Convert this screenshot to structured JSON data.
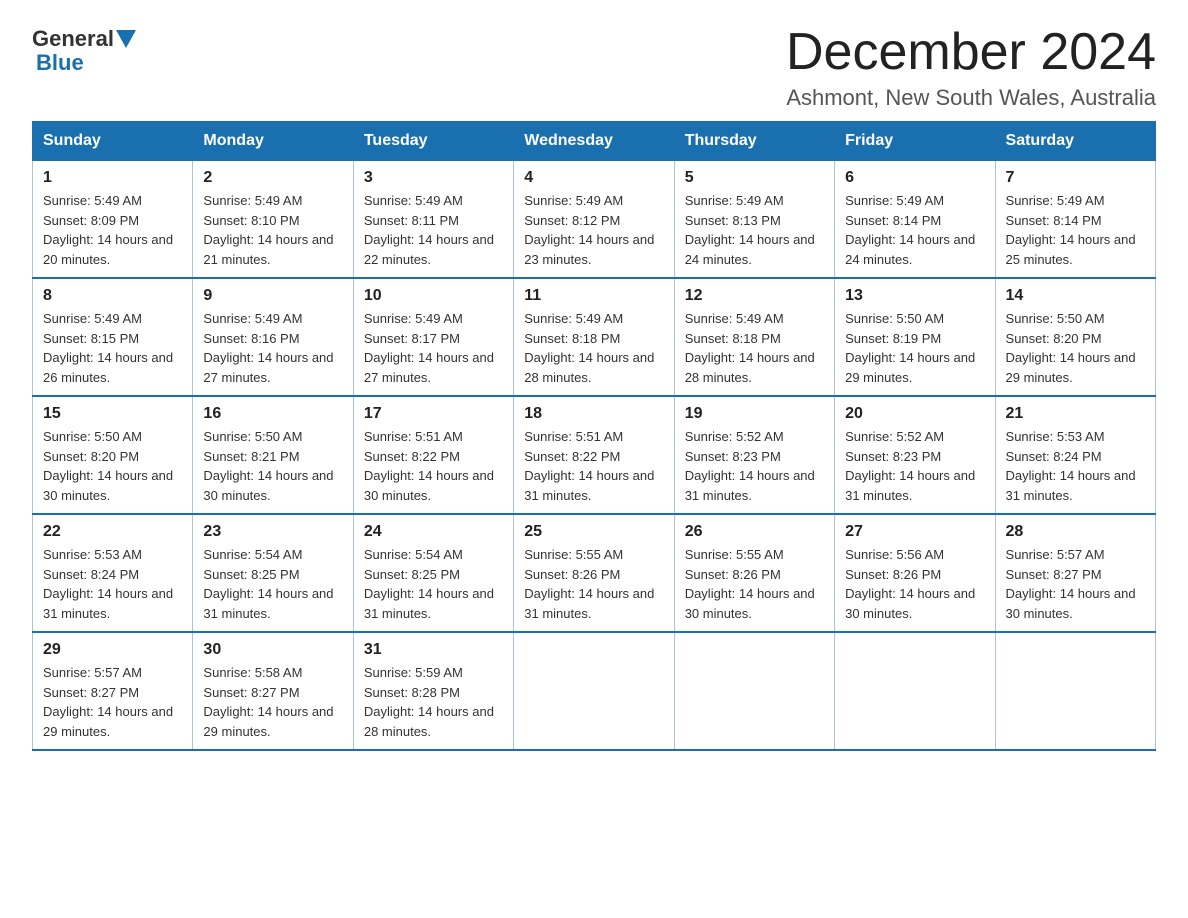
{
  "header": {
    "logo_general": "General",
    "logo_blue": "Blue",
    "month_title": "December 2024",
    "location": "Ashmont, New South Wales, Australia"
  },
  "weekdays": [
    "Sunday",
    "Monday",
    "Tuesday",
    "Wednesday",
    "Thursday",
    "Friday",
    "Saturday"
  ],
  "weeks": [
    [
      {
        "day": "1",
        "sunrise": "5:49 AM",
        "sunset": "8:09 PM",
        "daylight": "14 hours and 20 minutes."
      },
      {
        "day": "2",
        "sunrise": "5:49 AM",
        "sunset": "8:10 PM",
        "daylight": "14 hours and 21 minutes."
      },
      {
        "day": "3",
        "sunrise": "5:49 AM",
        "sunset": "8:11 PM",
        "daylight": "14 hours and 22 minutes."
      },
      {
        "day": "4",
        "sunrise": "5:49 AM",
        "sunset": "8:12 PM",
        "daylight": "14 hours and 23 minutes."
      },
      {
        "day": "5",
        "sunrise": "5:49 AM",
        "sunset": "8:13 PM",
        "daylight": "14 hours and 24 minutes."
      },
      {
        "day": "6",
        "sunrise": "5:49 AM",
        "sunset": "8:14 PM",
        "daylight": "14 hours and 24 minutes."
      },
      {
        "day": "7",
        "sunrise": "5:49 AM",
        "sunset": "8:14 PM",
        "daylight": "14 hours and 25 minutes."
      }
    ],
    [
      {
        "day": "8",
        "sunrise": "5:49 AM",
        "sunset": "8:15 PM",
        "daylight": "14 hours and 26 minutes."
      },
      {
        "day": "9",
        "sunrise": "5:49 AM",
        "sunset": "8:16 PM",
        "daylight": "14 hours and 27 minutes."
      },
      {
        "day": "10",
        "sunrise": "5:49 AM",
        "sunset": "8:17 PM",
        "daylight": "14 hours and 27 minutes."
      },
      {
        "day": "11",
        "sunrise": "5:49 AM",
        "sunset": "8:18 PM",
        "daylight": "14 hours and 28 minutes."
      },
      {
        "day": "12",
        "sunrise": "5:49 AM",
        "sunset": "8:18 PM",
        "daylight": "14 hours and 28 minutes."
      },
      {
        "day": "13",
        "sunrise": "5:50 AM",
        "sunset": "8:19 PM",
        "daylight": "14 hours and 29 minutes."
      },
      {
        "day": "14",
        "sunrise": "5:50 AM",
        "sunset": "8:20 PM",
        "daylight": "14 hours and 29 minutes."
      }
    ],
    [
      {
        "day": "15",
        "sunrise": "5:50 AM",
        "sunset": "8:20 PM",
        "daylight": "14 hours and 30 minutes."
      },
      {
        "day": "16",
        "sunrise": "5:50 AM",
        "sunset": "8:21 PM",
        "daylight": "14 hours and 30 minutes."
      },
      {
        "day": "17",
        "sunrise": "5:51 AM",
        "sunset": "8:22 PM",
        "daylight": "14 hours and 30 minutes."
      },
      {
        "day": "18",
        "sunrise": "5:51 AM",
        "sunset": "8:22 PM",
        "daylight": "14 hours and 31 minutes."
      },
      {
        "day": "19",
        "sunrise": "5:52 AM",
        "sunset": "8:23 PM",
        "daylight": "14 hours and 31 minutes."
      },
      {
        "day": "20",
        "sunrise": "5:52 AM",
        "sunset": "8:23 PM",
        "daylight": "14 hours and 31 minutes."
      },
      {
        "day": "21",
        "sunrise": "5:53 AM",
        "sunset": "8:24 PM",
        "daylight": "14 hours and 31 minutes."
      }
    ],
    [
      {
        "day": "22",
        "sunrise": "5:53 AM",
        "sunset": "8:24 PM",
        "daylight": "14 hours and 31 minutes."
      },
      {
        "day": "23",
        "sunrise": "5:54 AM",
        "sunset": "8:25 PM",
        "daylight": "14 hours and 31 minutes."
      },
      {
        "day": "24",
        "sunrise": "5:54 AM",
        "sunset": "8:25 PM",
        "daylight": "14 hours and 31 minutes."
      },
      {
        "day": "25",
        "sunrise": "5:55 AM",
        "sunset": "8:26 PM",
        "daylight": "14 hours and 31 minutes."
      },
      {
        "day": "26",
        "sunrise": "5:55 AM",
        "sunset": "8:26 PM",
        "daylight": "14 hours and 30 minutes."
      },
      {
        "day": "27",
        "sunrise": "5:56 AM",
        "sunset": "8:26 PM",
        "daylight": "14 hours and 30 minutes."
      },
      {
        "day": "28",
        "sunrise": "5:57 AM",
        "sunset": "8:27 PM",
        "daylight": "14 hours and 30 minutes."
      }
    ],
    [
      {
        "day": "29",
        "sunrise": "5:57 AM",
        "sunset": "8:27 PM",
        "daylight": "14 hours and 29 minutes."
      },
      {
        "day": "30",
        "sunrise": "5:58 AM",
        "sunset": "8:27 PM",
        "daylight": "14 hours and 29 minutes."
      },
      {
        "day": "31",
        "sunrise": "5:59 AM",
        "sunset": "8:28 PM",
        "daylight": "14 hours and 28 minutes."
      },
      null,
      null,
      null,
      null
    ]
  ]
}
